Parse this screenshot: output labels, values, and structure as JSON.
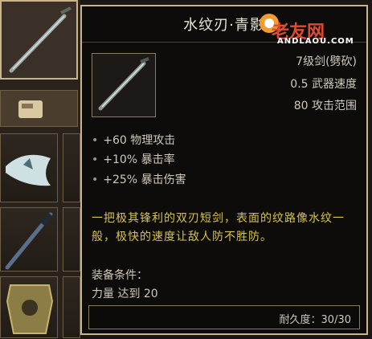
{
  "inventory": {
    "slots": [
      "sword-slot",
      "scroll-slot",
      "fish-slot",
      "spear-slot",
      "armor-slot"
    ]
  },
  "tooltip": {
    "title": "水纹刃·青影",
    "weapon_type": "7级剑(劈砍)",
    "weapon_speed": "0.5 武器速度",
    "attack_range": "80 攻击范围",
    "bonuses": [
      {
        "bullet": "•",
        "text": "+60 物理攻击"
      },
      {
        "bullet": "•",
        "text": "+10% 暴击率"
      },
      {
        "bullet": "•",
        "text": "+25% 暴击伤害"
      }
    ],
    "description": "一把极其锋利的双刃短剑，表面的纹路像水纹一般，极快的速度让敌人防不胜防。",
    "requirement_title": "装备条件：",
    "requirement_line": "力量 达到 20",
    "durability": "耐久度：30/30"
  },
  "watermark": {
    "text": "老友网",
    "url": "ANDLAOU.COM",
    "color": "#e04a2f"
  },
  "colors": {
    "border": "#c9b48b",
    "desc_text": "#d6c34d",
    "stat_text": "#cfc8bb"
  }
}
